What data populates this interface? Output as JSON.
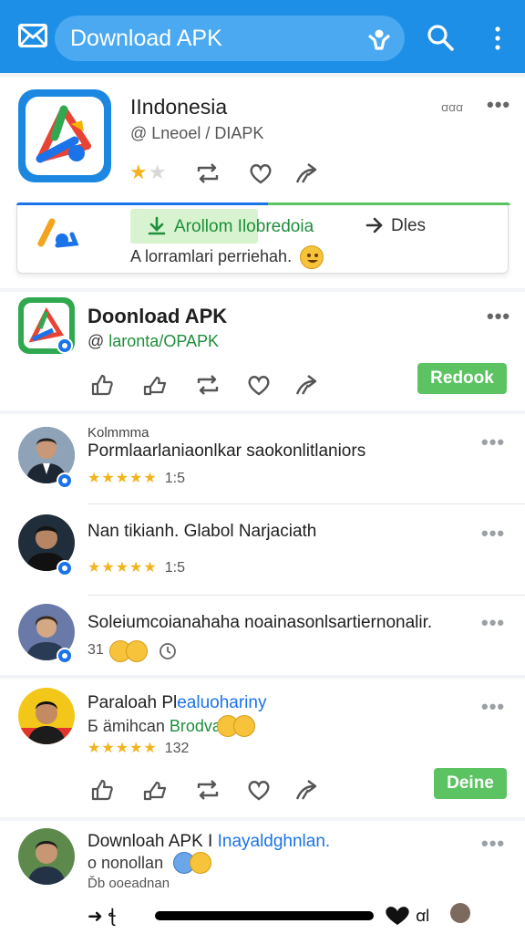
{
  "topbar": {
    "search_label": "Download APK",
    "icons": {
      "left": "mail-icon",
      "person": "person-icon",
      "search": "search-icon",
      "more": "more-vert-icon"
    },
    "color": "#1d8fe6"
  },
  "post1": {
    "title": "IIndonesia",
    "handle": "@ Lneoel / DIAPK",
    "meta": "ꭤꭤꭤ",
    "box": {
      "chip_label": "Arollom Ilobredoia",
      "secondary": "Dles",
      "caption": "A lorramlari perriehah."
    }
  },
  "post2": {
    "title": "Doonload APK",
    "handle_prefix": "@ ",
    "handle": "laronta/OPAPK",
    "button": "Redook"
  },
  "comments": [
    {
      "header": "Kolmmma",
      "title": "Pormlaarlaniaonlkar saokonlitlaniors",
      "rating": "1:5"
    },
    {
      "title": "Nan tikianh. Glabol Narjaciath",
      "rating": "1:5"
    },
    {
      "title": "Soleiumcoianahaha noainasonlsartiernonalir.",
      "rating": "31"
    }
  ],
  "post3": {
    "title_a": "Paraloah Pl",
    "title_b": "ealuohariny",
    "sub_a": "Б ämihcan ",
    "sub_b": "Brodvat",
    "rating": "132",
    "button": "Deine"
  },
  "post4": {
    "title_a": "Downloah APK I ",
    "title_b": "Inayaldghnlan.",
    "sub": "o nonollan",
    "sub2": "Ďb ooeadnan"
  },
  "bottom": {
    "left": "➜ ꞎ",
    "right": "ꭤl"
  }
}
